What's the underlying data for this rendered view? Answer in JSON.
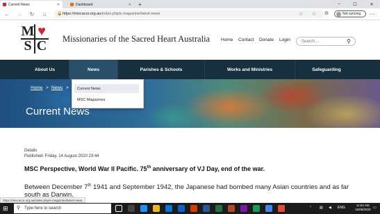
{
  "browser": {
    "tabs": [
      {
        "title": "Current News",
        "active": true
      },
      {
        "title": "Dashboard",
        "active": false
      }
    ],
    "new_tab": "+",
    "url_host": "https://miscacor.org.au",
    "url_path": "/index.php/e-magazine/latest-news",
    "sync_label": "Not syncing",
    "status_url": "https://miscacor.org.au/index.php/e-magazine/latest-news"
  },
  "site": {
    "logo_letters": [
      "M",
      "",
      "S",
      "C"
    ],
    "title": "Missionaries of the Sacred Heart Australia",
    "top_links": [
      "Home",
      "Contact",
      "Donate",
      "Login"
    ],
    "search_placeholder": "Search ..."
  },
  "nav": {
    "items": [
      "About Us",
      "News",
      "Parishes & Schools",
      "Works and Ministries",
      "Safeguarding"
    ],
    "dropdown": [
      "Current News",
      "MSC Magazines"
    ]
  },
  "hero": {
    "breadcrumb": [
      "Home",
      ">",
      "News",
      ">"
    ],
    "title": "Current News"
  },
  "article": {
    "details_label": "Details",
    "published": "Published: Friday, 14 August 2020 23:44",
    "heading_a": "MSC Perspective, World War II Pacific. 75",
    "heading_sup": "th",
    "heading_b": " anniversary of VJ Day, end of the war.",
    "body_a": "Between December 7",
    "body_sup": "th",
    "body_b": " 1941 and September 1942, the Japanese had bombed many Asian countries and as far south as Darwin."
  },
  "taskbar": {
    "search_placeholder": "Type here to search",
    "time": "11:54 AM",
    "date": "15/08/2020",
    "lang": "ENG"
  },
  "colors": {
    "nav_bg": "#17303f",
    "nav_active": "#2a4f6b",
    "logo_heart": "#d8232a"
  }
}
